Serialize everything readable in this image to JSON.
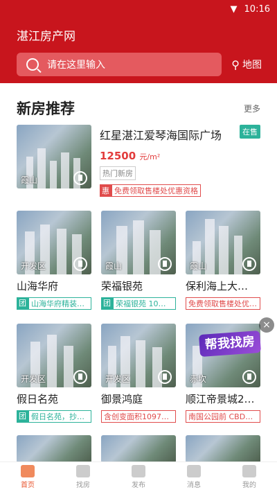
{
  "status": {
    "time": "10:16",
    "wifi_icon": "wifi-icon"
  },
  "header": {
    "title": "湛江房产网",
    "search_placeholder": "请在这里输入",
    "map_label": "地图"
  },
  "section": {
    "title": "新房推荐",
    "more": "更多"
  },
  "featured": {
    "name": "红星湛江爱琴海国际广场",
    "status": "在售",
    "price": "12500",
    "price_unit": "元/m²",
    "tag": "热门新房",
    "promo_badge": "惠",
    "promo_text": "免费领取售楼处优惠资格",
    "area": "霞山"
  },
  "row1": [
    {
      "name": "山海华府",
      "area": "开发区",
      "badge": "团",
      "promo": "山海华府精装…",
      "style": "teal"
    },
    {
      "name": "荣福银苑",
      "area": "霞山",
      "badge": "团",
      "promo": "荣福银苑 10套…",
      "style": "teal"
    },
    {
      "name": "保利海上大…",
      "area": "霞山",
      "badge": "",
      "promo": "免费领取售楼处优…",
      "style": "red"
    }
  ],
  "row2": [
    {
      "name": "假日名苑",
      "area": "开发区",
      "badge": "团",
      "promo": "假日名苑，抄…",
      "style": "teal"
    },
    {
      "name": "御景鸿庭",
      "area": "开发区",
      "badge": "",
      "promo": "含创变面积10975…",
      "style": "red"
    },
    {
      "name": "顺江帝景城2…",
      "area": "赤坎",
      "badge": "",
      "promo": "南国公园前 CBD商…",
      "style": "red"
    }
  ],
  "float_ad": {
    "text": "帮我找房",
    "close": "×"
  },
  "tabs": [
    {
      "label": "首页",
      "icon": "home-icon"
    },
    {
      "label": "找房",
      "icon": "building-icon"
    },
    {
      "label": "发布",
      "icon": "publish-icon"
    },
    {
      "label": "消息",
      "icon": "message-icon"
    },
    {
      "label": "我的",
      "icon": "user-icon"
    }
  ]
}
